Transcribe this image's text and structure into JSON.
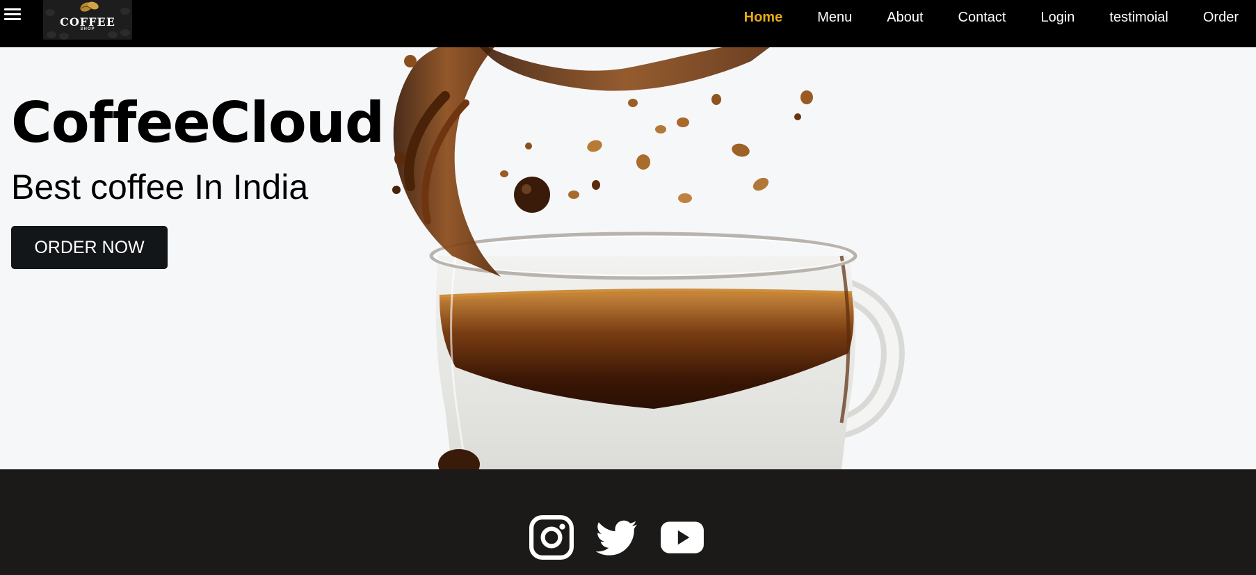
{
  "nav": {
    "menu_icon": "hamburger-menu-icon",
    "logo": {
      "title": "COFFEE",
      "subtitle": "SHOP"
    },
    "links": [
      {
        "label": "Home",
        "active": true
      },
      {
        "label": "Menu"
      },
      {
        "label": "About"
      },
      {
        "label": "Contact"
      },
      {
        "label": "Login"
      },
      {
        "label": "testimoial"
      },
      {
        "label": "Order"
      }
    ],
    "active_color": "#e8ab16"
  },
  "hero": {
    "title": "CoffeeCloud",
    "subtitle": "Best coffee In India",
    "cta_label": "ORDER NOW"
  },
  "footer": {
    "social_icons": [
      "instagram-icon",
      "twitter-icon",
      "youtube-icon"
    ]
  }
}
